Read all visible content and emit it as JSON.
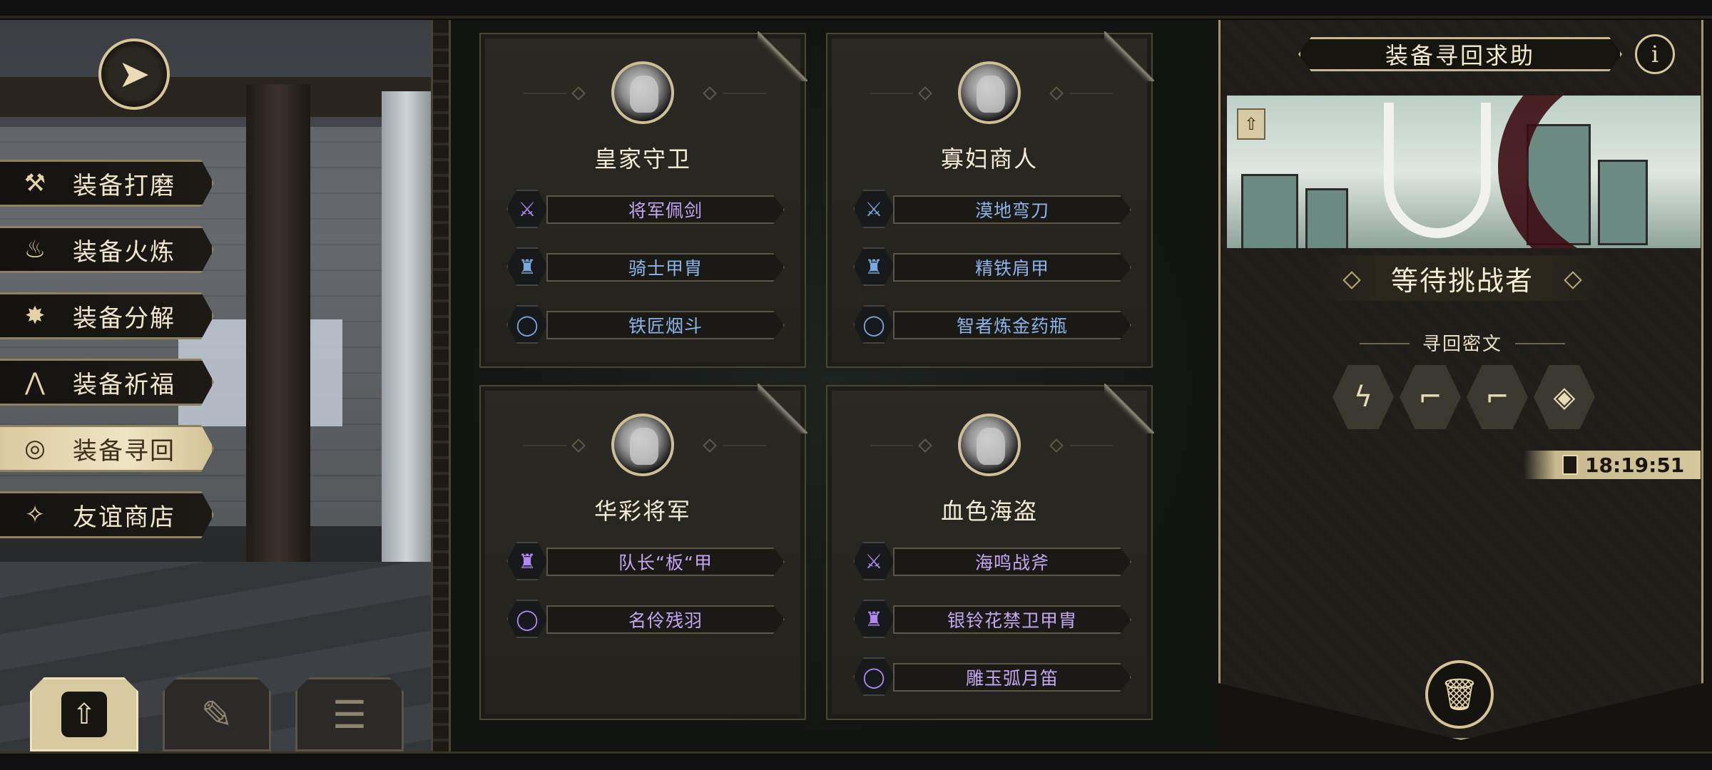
{
  "left_menu": {
    "items": [
      {
        "label": "装备打磨",
        "icon": "hammer-icon",
        "glyph": "⚒",
        "active": false
      },
      {
        "label": "装备火炼",
        "icon": "flame-icon",
        "glyph": "♨",
        "active": false
      },
      {
        "label": "装备分解",
        "icon": "break-icon",
        "glyph": "✸",
        "active": false
      },
      {
        "label": "装备祈福",
        "icon": "pray-icon",
        "glyph": "⋀",
        "active": false
      },
      {
        "label": "装备寻回",
        "icon": "target-icon",
        "glyph": "◎",
        "active": true
      },
      {
        "label": "友谊商店",
        "icon": "fox-icon",
        "glyph": "✧",
        "active": false
      }
    ]
  },
  "bottom_tabs": [
    {
      "icon": "upload-icon",
      "glyph": "⇧",
      "active": true
    },
    {
      "icon": "quill-icon",
      "glyph": "✎",
      "active": false
    },
    {
      "icon": "list-icon",
      "glyph": "☰",
      "active": false
    }
  ],
  "cards": [
    {
      "title": "皇家守卫",
      "items": [
        {
          "label": "将军佩剑",
          "rarity": "purple",
          "icon": "sword-icon",
          "glyph": "⚔"
        },
        {
          "label": "骑士甲胄",
          "rarity": "blue",
          "icon": "armor-icon",
          "glyph": "♜"
        },
        {
          "label": "铁匠烟斗",
          "rarity": "blue",
          "icon": "ring-icon",
          "glyph": "◯"
        }
      ]
    },
    {
      "title": "寡妇商人",
      "items": [
        {
          "label": "漠地弯刀",
          "rarity": "blue",
          "icon": "sword-icon",
          "glyph": "⚔"
        },
        {
          "label": "精铁肩甲",
          "rarity": "blue",
          "icon": "armor-icon",
          "glyph": "♜"
        },
        {
          "label": "智者炼金药瓶",
          "rarity": "blue",
          "icon": "ring-icon",
          "glyph": "◯"
        }
      ]
    },
    {
      "title": "华彩将军",
      "items": [
        {
          "label": "队长“板“甲",
          "rarity": "purple",
          "icon": "armor-icon",
          "glyph": "♜"
        },
        {
          "label": "名伶残羽",
          "rarity": "purple",
          "icon": "ring-icon",
          "glyph": "◯"
        }
      ]
    },
    {
      "title": "血色海盗",
      "items": [
        {
          "label": "海鸣战斧",
          "rarity": "purple",
          "icon": "sword-icon",
          "glyph": "⚔"
        },
        {
          "label": "银铃花禁卫甲胄",
          "rarity": "purple",
          "icon": "armor-icon",
          "glyph": "♜"
        },
        {
          "label": "雕玉弧月笛",
          "rarity": "purple",
          "icon": "ring-icon",
          "glyph": "◯"
        }
      ]
    }
  ],
  "panel": {
    "title": "装备寻回求助",
    "status": "等待挑战者",
    "code_label": "寻回密文",
    "codes": [
      {
        "icon": "zigzag-rune-icon",
        "glyph": "ϟ"
      },
      {
        "icon": "step-rune-icon",
        "glyph": "⌐"
      },
      {
        "icon": "step-rune-icon",
        "glyph": "⌐"
      },
      {
        "icon": "diamond-rune-icon",
        "glyph": "◈"
      }
    ],
    "timer": "18:19:51"
  },
  "colors": {
    "accent_gold": "#d6c698",
    "rarity_blue": "#8db4e8",
    "rarity_purple": "#c4a6f2"
  }
}
